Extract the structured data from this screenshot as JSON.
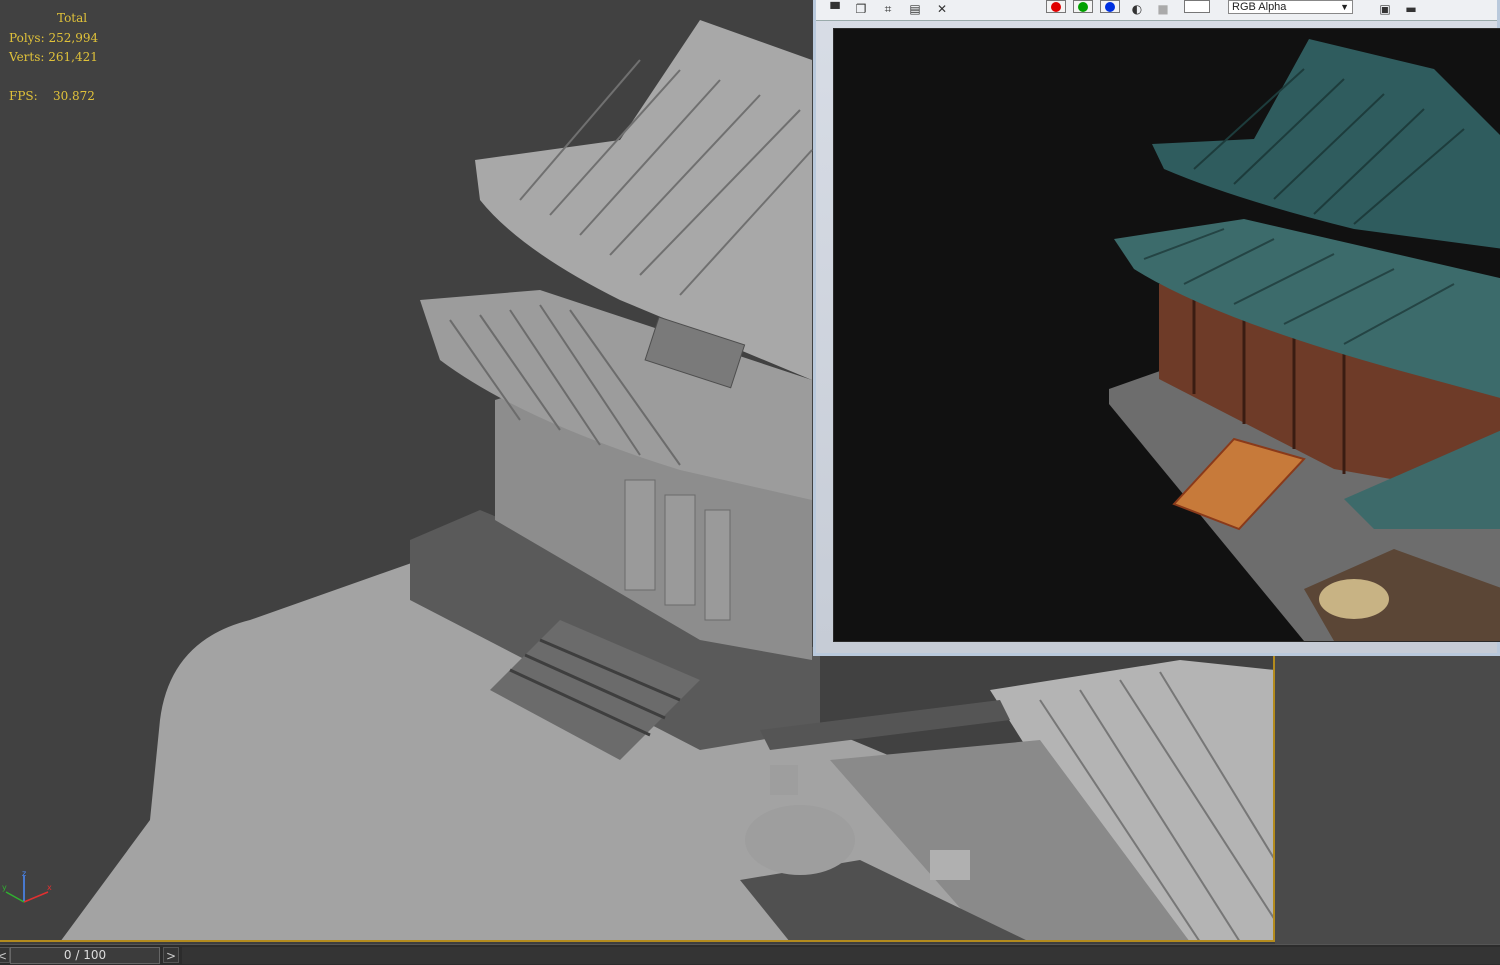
{
  "viewport": {
    "stats": {
      "total_label": "Total",
      "polys_label": "Polys:",
      "polys_value": "252,994",
      "verts_label": "Verts:",
      "verts_value": "261,421",
      "fps_label": "FPS:",
      "fps_value": "30.872"
    },
    "axis": {
      "x": "x",
      "y": "y",
      "z": "z"
    }
  },
  "frame_window": {
    "toolbar": {
      "icons": [
        "save-icon",
        "copy-icon",
        "clone-icon",
        "print-icon",
        "clear-icon"
      ],
      "channels": [
        "red",
        "green",
        "blue"
      ],
      "channel_display": "RGB Alpha"
    }
  },
  "timeline": {
    "prev": "<",
    "frame_counter": "0 / 100",
    "next": ">"
  },
  "colors": {
    "stats_text": "#e0c23a",
    "viewport_bg": "#414141",
    "active_border": "#b38b1e",
    "render_bg": "#111111"
  }
}
